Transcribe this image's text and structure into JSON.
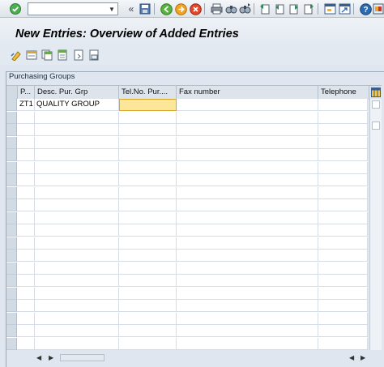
{
  "systoolbar": {
    "command_field": {
      "value": "",
      "placeholder": ""
    },
    "icons": [
      "enter-icon",
      "back-double-arrow-icon",
      "save-icon",
      "back-icon",
      "exit-icon",
      "cancel-icon",
      "print-icon",
      "find-icon",
      "find-next-icon",
      "first-page-icon",
      "previous-page-icon",
      "next-page-icon",
      "last-page-icon",
      "new-session-icon",
      "shortcut-icon",
      "help-icon",
      "customize-layout-icon"
    ]
  },
  "title": "New Entries: Overview of Added Entries",
  "apptoolbar": {
    "icons": [
      "display-change-icon",
      "new-entries-icon",
      "copy-as-icon",
      "delete-icon",
      "undo-change-icon",
      "select-all-icon"
    ]
  },
  "group": {
    "title": "Purchasing Groups"
  },
  "table": {
    "columns": [
      "P...",
      "Desc. Pur. Grp",
      "Tel.No. Pur....",
      "Fax number",
      "Telephone"
    ],
    "rows": [
      [
        "ZT1",
        "QUALITY GROUP",
        "",
        "",
        ""
      ]
    ],
    "empty_rows": 19
  },
  "colors": {
    "background": "#dfe6ef",
    "active_cell": "#fbe69a",
    "active_cell_border": "#d8a72a"
  }
}
